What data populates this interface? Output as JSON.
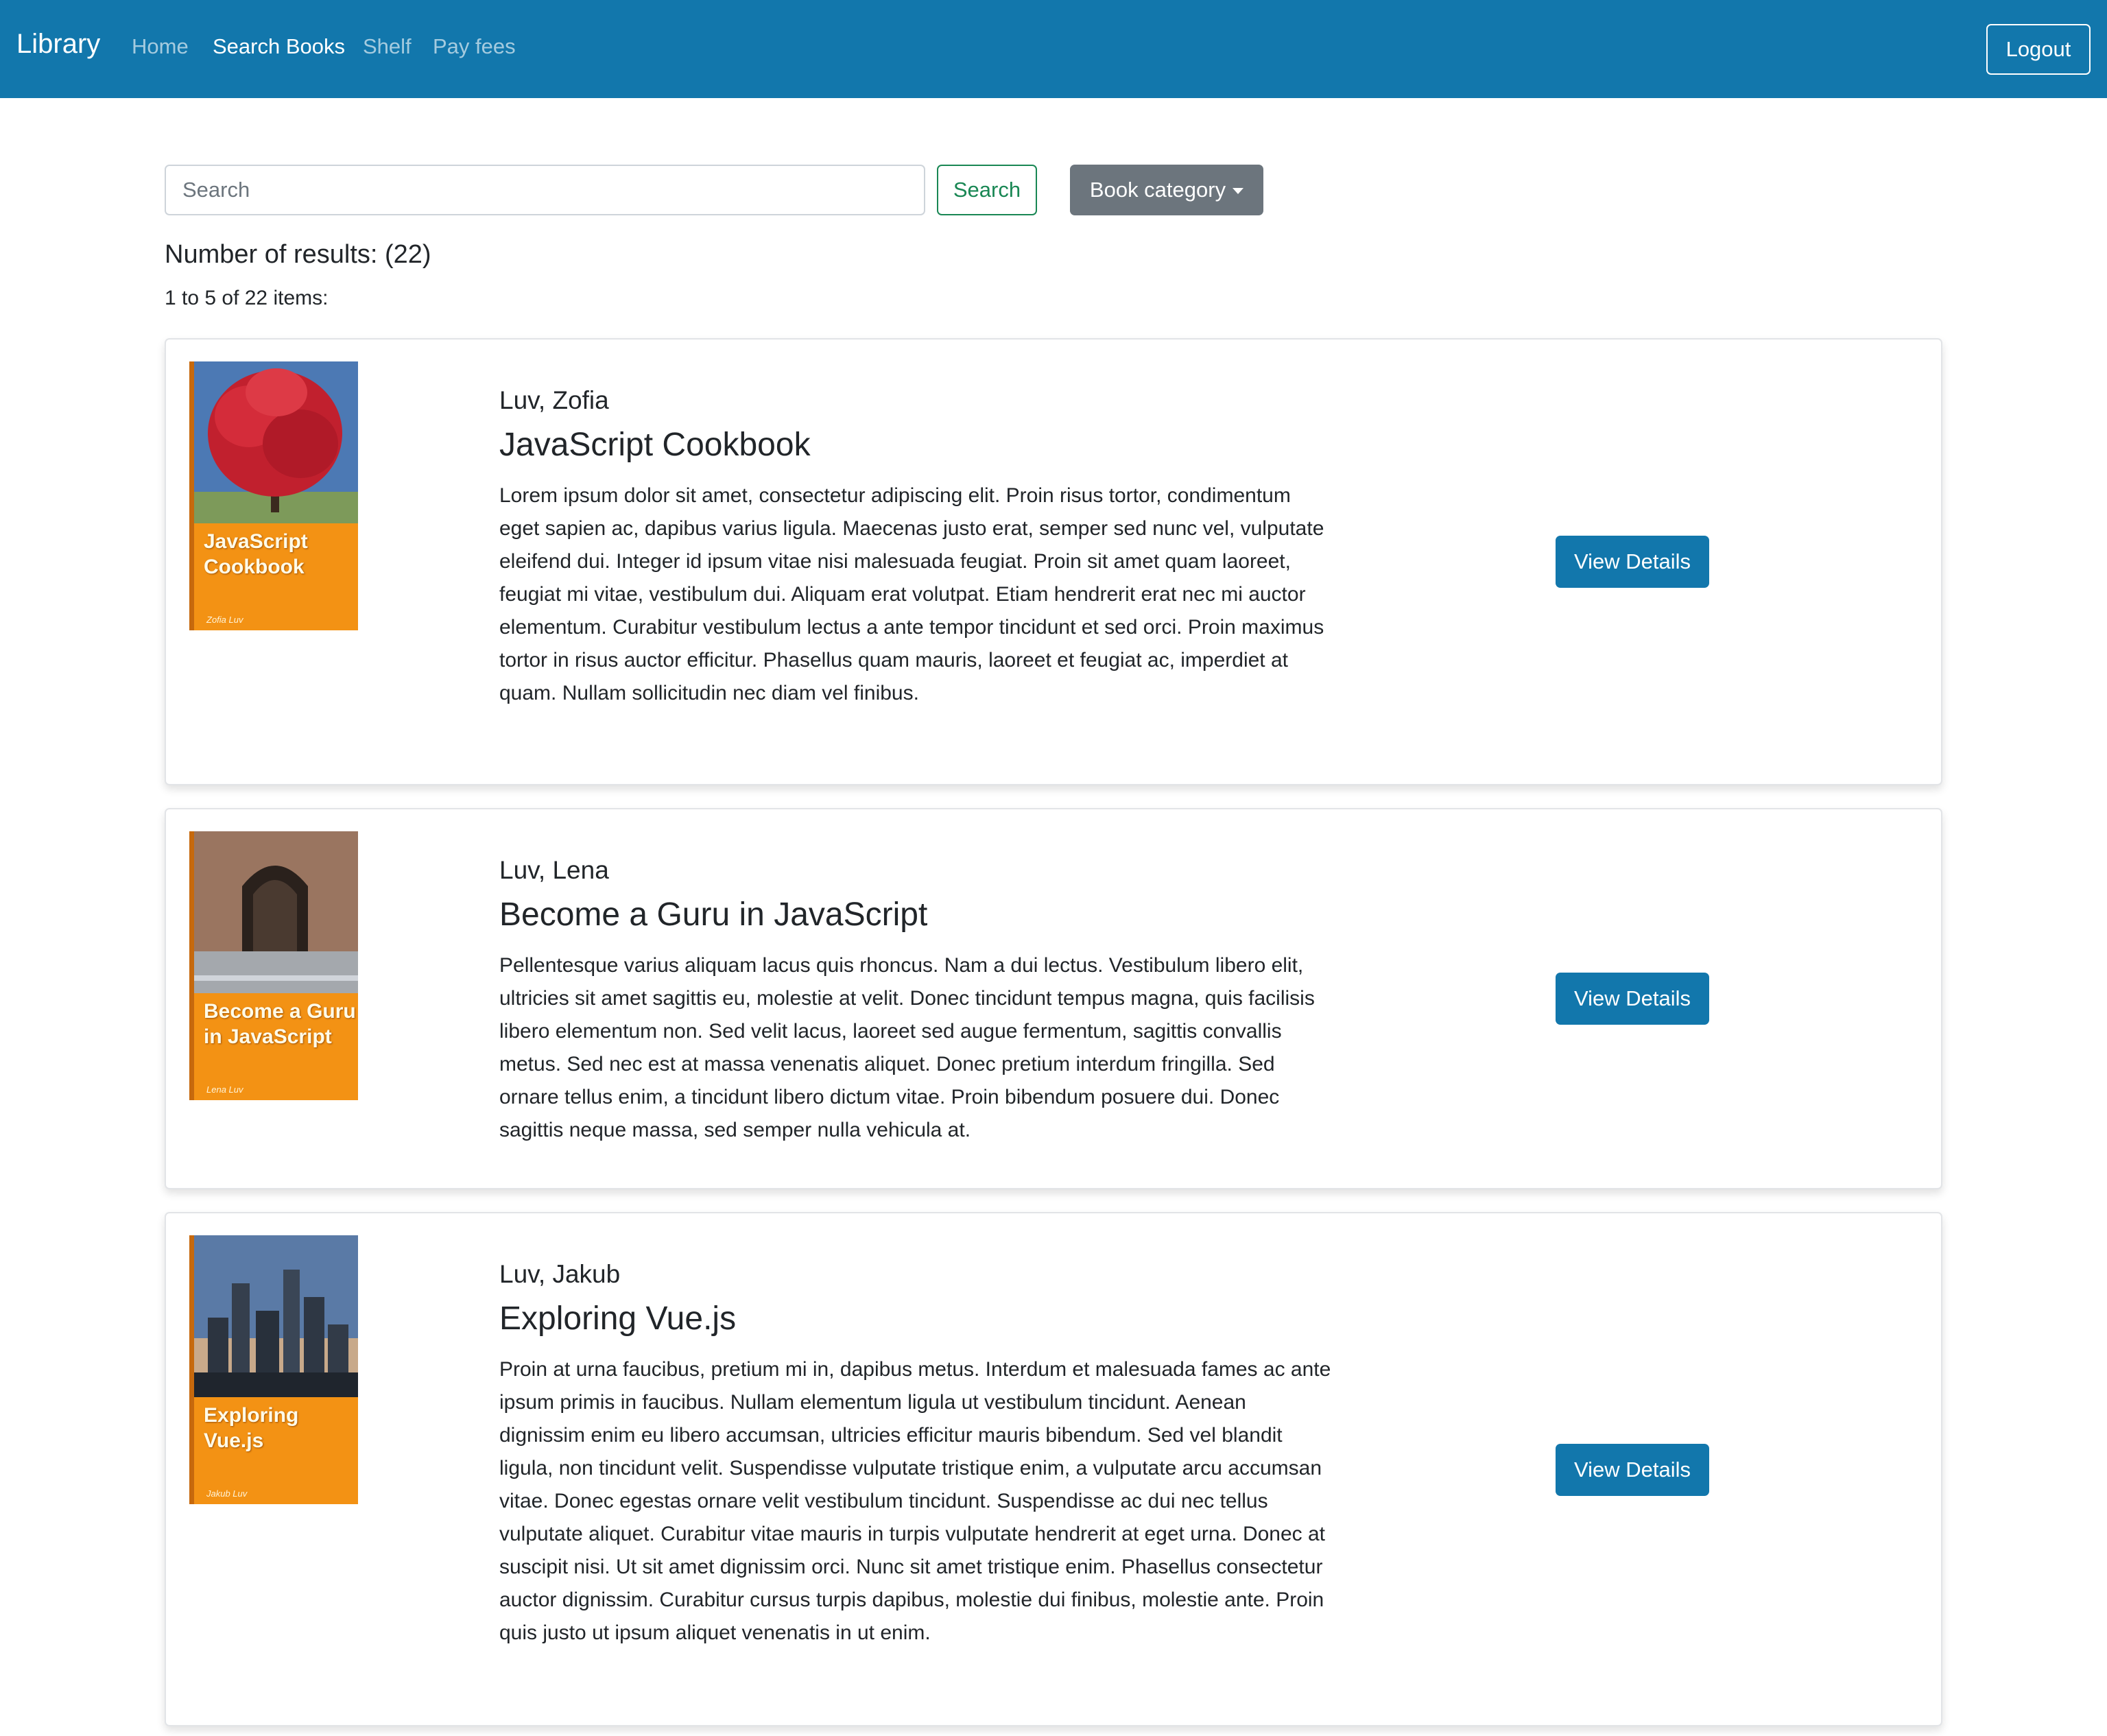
{
  "navbar": {
    "brand": "Library",
    "links": [
      "Home",
      "Search Books",
      "Shelf",
      "Pay fees"
    ],
    "active_link": "Search Books",
    "logout_label": "Logout",
    "color": "#1277ac"
  },
  "search": {
    "placeholder": "Search",
    "value": "",
    "button_label": "Search",
    "category_label": "Book category"
  },
  "results": {
    "count_label": "Number of results: (22)",
    "range_label": "1 to 5 of 22 items:"
  },
  "books": [
    {
      "author": "Luv, Zofia",
      "title": "JavaScript Cookbook",
      "cover_title": "JavaScript Cookbook",
      "cover_author": "Zofia Luv",
      "description": "Lorem ipsum dolor sit amet, consectetur adipiscing elit. Proin risus tortor, condimentum eget sapien ac, dapibus varius ligula. Maecenas justo erat, semper sed nunc vel, vulputate eleifend dui. Integer id ipsum vitae nisi malesuada feugiat. Proin sit amet quam laoreet, feugiat mi vitae, vestibulum dui. Aliquam erat volutpat. Etiam hendrerit erat nec mi auctor elementum. Curabitur vestibulum lectus a ante tempor tincidunt et sed orci. Proin maximus tortor in risus auctor efficitur. Phasellus quam mauris, laoreet et feugiat ac, imperdiet at quam. Nullam sollicitudin nec diam vel finibus.",
      "button_label": "View Details"
    },
    {
      "author": "Luv, Lena",
      "title": "Become a Guru in JavaScript",
      "cover_title": "Become a Guru in JavaScript",
      "cover_author": "Lena Luv",
      "description": "Pellentesque varius aliquam lacus quis rhoncus. Nam a dui lectus. Vestibulum libero elit, ultricies sit amet sagittis eu, molestie at velit. Donec tincidunt tempus magna, quis facilisis libero elementum non. Sed velit lacus, laoreet sed augue fermentum, sagittis convallis metus. Sed nec est at massa venenatis aliquet. Donec pretium interdum fringilla. Sed ornare tellus enim, a tincidunt libero dictum vitae. Proin bibendum posuere dui. Donec sagittis neque massa, sed semper nulla vehicula at.",
      "button_label": "View Details"
    },
    {
      "author": "Luv, Jakub",
      "title": "Exploring Vue.js",
      "cover_title": "Exploring Vue.js",
      "cover_author": "Jakub Luv",
      "description": "Proin at urna faucibus, pretium mi in, dapibus metus. Interdum et malesuada fames ac ante ipsum primis in faucibus. Nullam elementum ligula ut vestibulum tincidunt. Aenean dignissim enim eu libero accumsan, ultricies efficitur mauris bibendum. Sed vel blandit ligula, non tincidunt velit. Suspendisse vulputate tristique enim, a vulputate arcu accumsan vitae. Donec egestas ornare velit vestibulum tincidunt. Suspendisse ac dui nec tellus vulputate aliquet. Curabitur vitae mauris in turpis vulputate hendrerit at eget urna. Donec at suscipit nisi. Ut sit amet dignissim orci. Nunc sit amet tristique enim. Phasellus consectetur auctor dignissim. Curabitur cursus turpis dapibus, molestie dui finibus, molestie ante. Proin quis justo ut ipsum aliquet venenatis in ut enim.",
      "button_label": "View Details"
    }
  ]
}
